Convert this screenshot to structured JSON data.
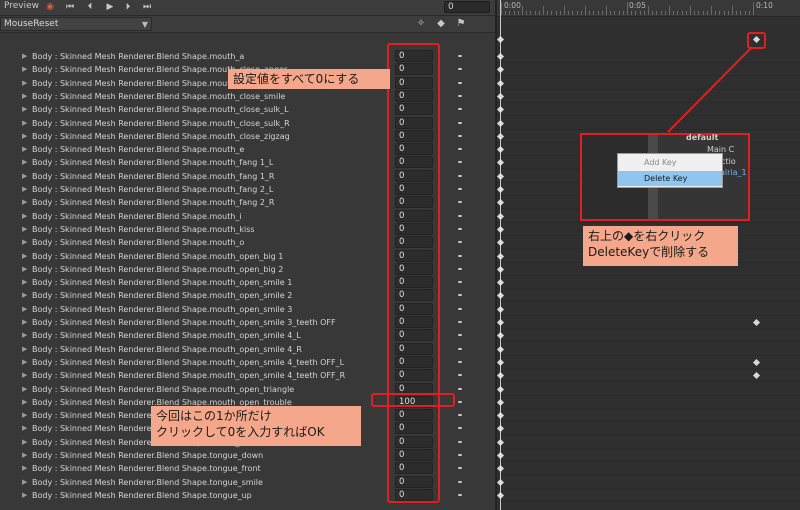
{
  "toolbar": {
    "preview_label": "Preview",
    "record_icon": "record-icon",
    "frame_value": "0"
  },
  "clip": {
    "name": "MouseReset"
  },
  "properties": [
    {
      "name": "Body : Skinned Mesh Renderer.Blend Shape.mouth_a",
      "value": "0"
    },
    {
      "name": "Body : Skinned Mesh Renderer.Blend Shape.mouth_close_anger",
      "value": "0"
    },
    {
      "name": "Body : Skinned Mesh Renderer.Blend Shape.mouth_close_m",
      "value": "0"
    },
    {
      "name": "Body : Skinned Mesh Renderer.Blend Shape.mouth_close_smile",
      "value": "0"
    },
    {
      "name": "Body : Skinned Mesh Renderer.Blend Shape.mouth_close_sulk_L",
      "value": "0"
    },
    {
      "name": "Body : Skinned Mesh Renderer.Blend Shape.mouth_close_sulk_R",
      "value": "0"
    },
    {
      "name": "Body : Skinned Mesh Renderer.Blend Shape.mouth_close_zigzag",
      "value": "0"
    },
    {
      "name": "Body : Skinned Mesh Renderer.Blend Shape.mouth_e",
      "value": "0"
    },
    {
      "name": "Body : Skinned Mesh Renderer.Blend Shape.mouth_fang 1_L",
      "value": "0"
    },
    {
      "name": "Body : Skinned Mesh Renderer.Blend Shape.mouth_fang 1_R",
      "value": "0"
    },
    {
      "name": "Body : Skinned Mesh Renderer.Blend Shape.mouth_fang 2_L",
      "value": "0"
    },
    {
      "name": "Body : Skinned Mesh Renderer.Blend Shape.mouth_fang 2_R",
      "value": "0"
    },
    {
      "name": "Body : Skinned Mesh Renderer.Blend Shape.mouth_i",
      "value": "0"
    },
    {
      "name": "Body : Skinned Mesh Renderer.Blend Shape.mouth_kiss",
      "value": "0"
    },
    {
      "name": "Body : Skinned Mesh Renderer.Blend Shape.mouth_o",
      "value": "0"
    },
    {
      "name": "Body : Skinned Mesh Renderer.Blend Shape.mouth_open_big 1",
      "value": "0"
    },
    {
      "name": "Body : Skinned Mesh Renderer.Blend Shape.mouth_open_big 2",
      "value": "0"
    },
    {
      "name": "Body : Skinned Mesh Renderer.Blend Shape.mouth_open_smile 1",
      "value": "0"
    },
    {
      "name": "Body : Skinned Mesh Renderer.Blend Shape.mouth_open_smile 2",
      "value": "0"
    },
    {
      "name": "Body : Skinned Mesh Renderer.Blend Shape.mouth_open_smile 3",
      "value": "0"
    },
    {
      "name": "Body : Skinned Mesh Renderer.Blend Shape.mouth_open_smile 3_teeth OFF",
      "value": "0"
    },
    {
      "name": "Body : Skinned Mesh Renderer.Blend Shape.mouth_open_smile 4_L",
      "value": "0"
    },
    {
      "name": "Body : Skinned Mesh Renderer.Blend Shape.mouth_open_smile 4_R",
      "value": "0"
    },
    {
      "name": "Body : Skinned Mesh Renderer.Blend Shape.mouth_open_smile 4_teeth OFF_L",
      "value": "0"
    },
    {
      "name": "Body : Skinned Mesh Renderer.Blend Shape.mouth_open_smile 4_teeth OFF_R",
      "value": "0"
    },
    {
      "name": "Body : Skinned Mesh Renderer.Blend Shape.mouth_open_triangle",
      "value": "0"
    },
    {
      "name": "Body : Skinned Mesh Renderer.Blend Shape.mouth_open_trouble",
      "value": "100"
    },
    {
      "name": "Body : Skinned Mesh Renderer.Blend Shape.mouth_pero",
      "value": "0"
    },
    {
      "name": "Body : Skinned Mesh Renderer.Blend Shape.mouth_small",
      "value": "0"
    },
    {
      "name": "Body : Skinned Mesh Renderer.Blend Shape.mouth_wide",
      "value": "0"
    },
    {
      "name": "Body : Skinned Mesh Renderer.Blend Shape.tongue_down",
      "value": "0"
    },
    {
      "name": "Body : Skinned Mesh Renderer.Blend Shape.tongue_front",
      "value": "0"
    },
    {
      "name": "Body : Skinned Mesh Renderer.Blend Shape.tongue_smile",
      "value": "0"
    },
    {
      "name": "Body : Skinned Mesh Renderer.Blend Shape.tongue_up",
      "value": "0"
    }
  ],
  "timeline": {
    "labels": [
      "0:00",
      "0:05",
      "0:10"
    ]
  },
  "callouts": {
    "set_all_zero": "設定値をすべて0にする",
    "right_click_line1": "右上の◆を右クリック",
    "right_click_line2": "DeleteKeyで削除する",
    "only_this_line1": "今回はこの1か所だけ",
    "only_this_line2": "クリックして0を入力すればOK"
  },
  "context_menu": {
    "add_key": "Add Key",
    "delete_key": "Delete Key"
  },
  "inset_hierarchy": {
    "root": "default",
    "item1": "Main C",
    "item2": "rectio",
    "item3": "alria_1"
  },
  "colors": {
    "callout_bg": "#f4a78a",
    "highlight_red": "#e41e1e",
    "menu_active": "#8fc6f0"
  }
}
